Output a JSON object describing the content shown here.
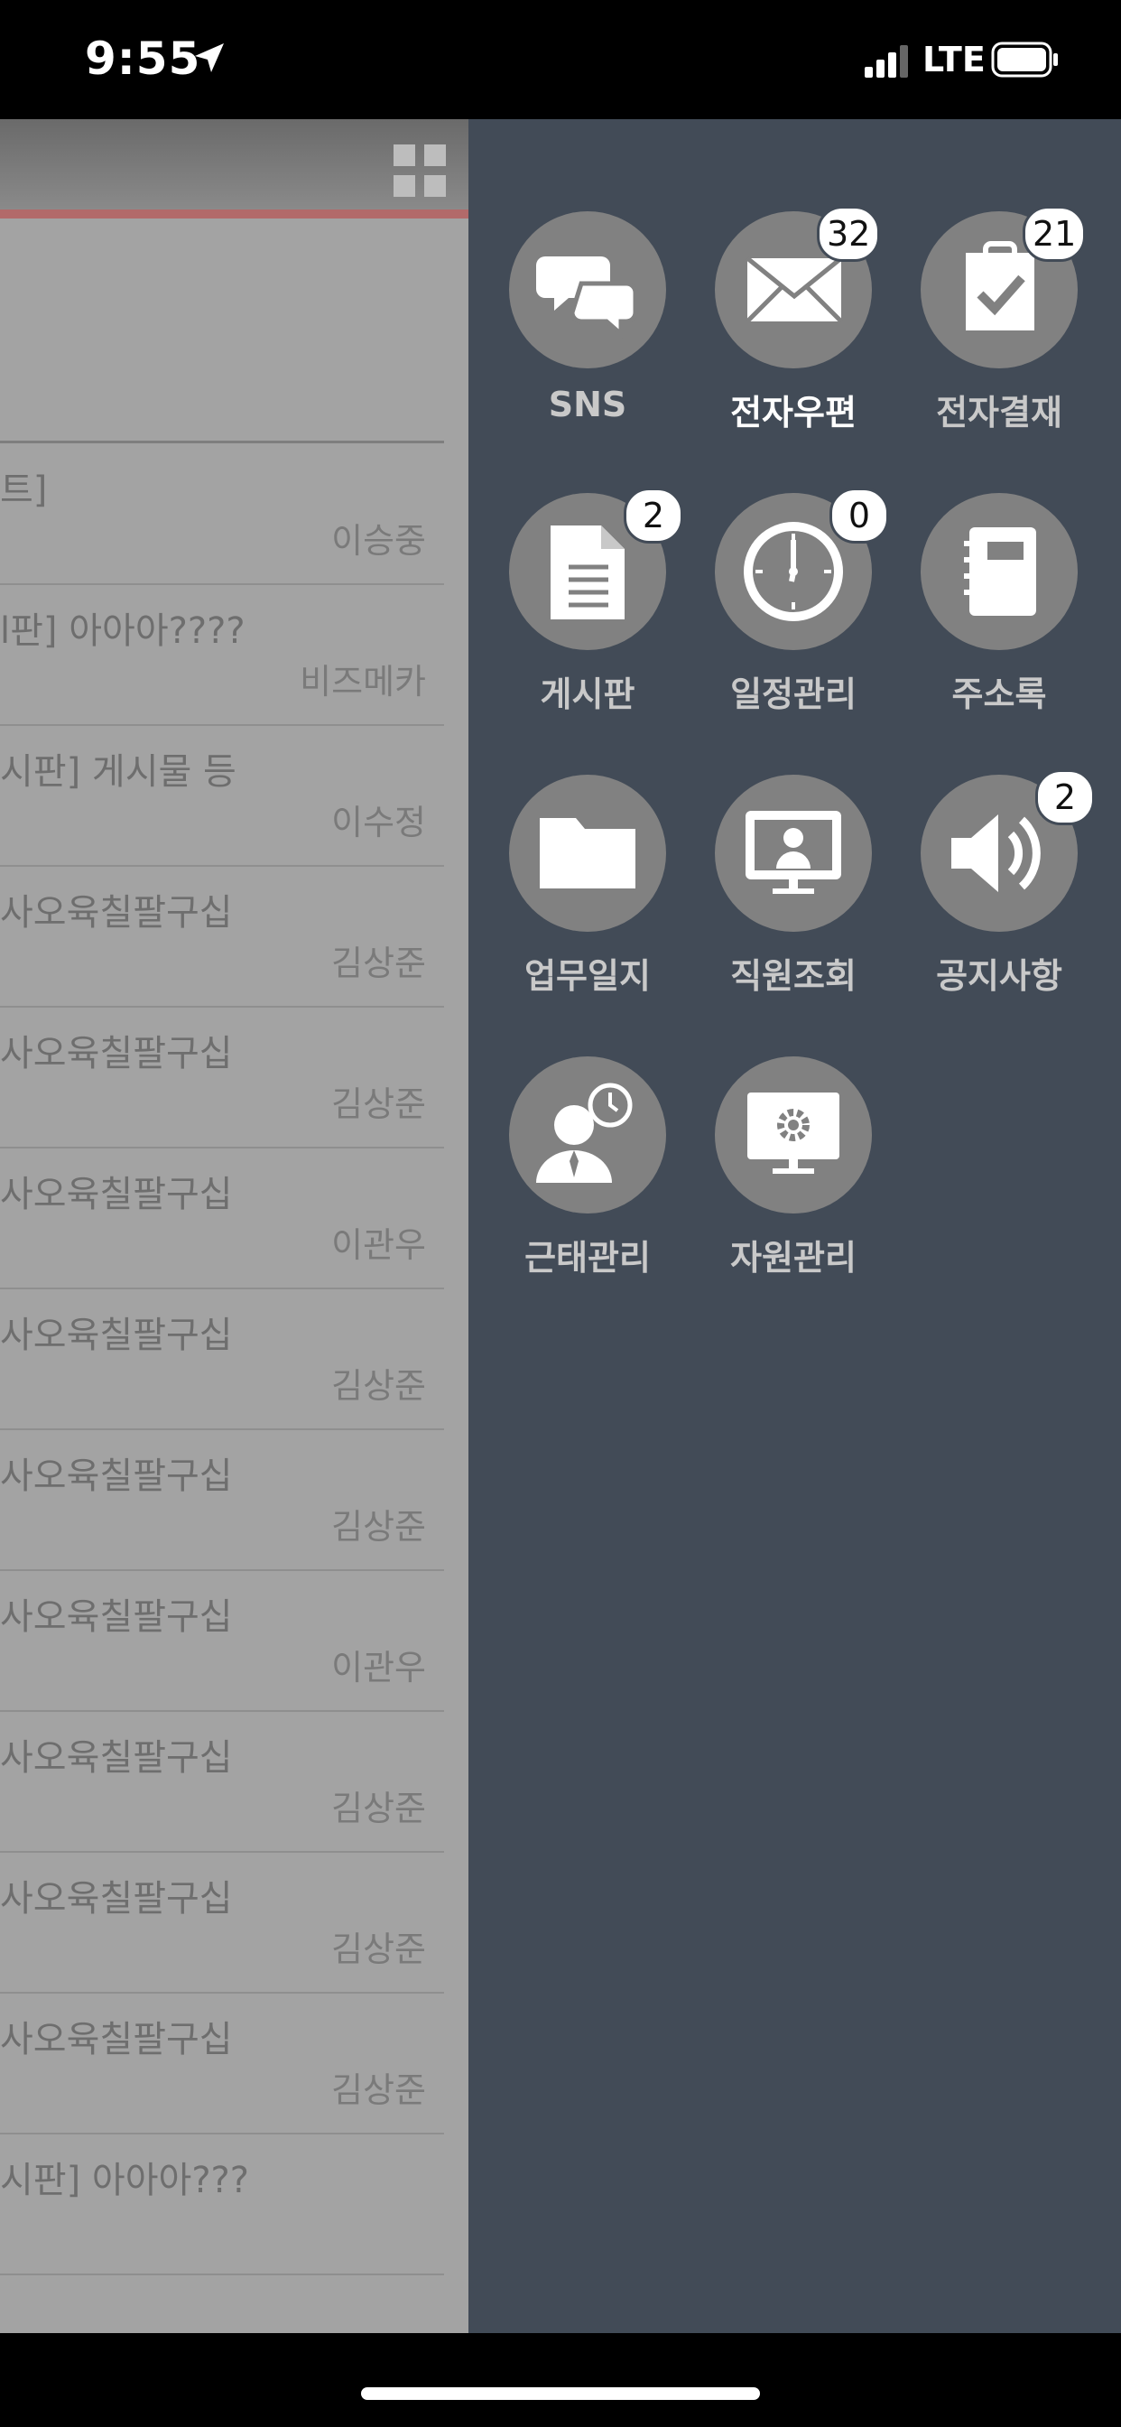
{
  "status_bar": {
    "time": "9:55",
    "network": "LTE"
  },
  "left_list": {
    "rows": [
      {
        "title": "트]",
        "author": "이승중"
      },
      {
        "title": "l판] 아아아????",
        "author": "비즈메카"
      },
      {
        "title": "시판] 게시물 등",
        "author": "이수정"
      },
      {
        "title": "사오육칠팔구십",
        "author": "김상준"
      },
      {
        "title": "사오육칠팔구십",
        "author": "김상준"
      },
      {
        "title": "사오육칠팔구십",
        "author": "이관우"
      },
      {
        "title": "사오육칠팔구십",
        "author": "김상준"
      },
      {
        "title": "사오육칠팔구십",
        "author": "김상준"
      },
      {
        "title": "사오육칠팔구십",
        "author": "이관우"
      },
      {
        "title": "사오육칠팔구십",
        "author": "김상준"
      },
      {
        "title": "사오육칠팔구십",
        "author": "김상준"
      },
      {
        "title": "사오육칠팔구십",
        "author": "김상준"
      },
      {
        "title": "시판] 아아아???",
        "author": ""
      }
    ]
  },
  "menu": {
    "items": [
      {
        "label": "SNS",
        "badge": "",
        "icon": "chat-bubbles-icon"
      },
      {
        "label": "전자우편",
        "badge": "32",
        "icon": "envelope-icon"
      },
      {
        "label": "전자결재",
        "badge": "21",
        "icon": "clipboard-check-icon"
      },
      {
        "label": "게시판",
        "badge": "2",
        "icon": "document-icon"
      },
      {
        "label": "일정관리",
        "badge": "0",
        "icon": "clock-icon"
      },
      {
        "label": "주소록",
        "badge": "",
        "icon": "address-book-icon"
      },
      {
        "label": "업무일지",
        "badge": "",
        "icon": "folder-icon"
      },
      {
        "label": "직원조회",
        "badge": "",
        "icon": "monitor-user-icon"
      },
      {
        "label": "공지사항",
        "badge": "2",
        "icon": "speaker-icon"
      },
      {
        "label": "근태관리",
        "badge": "",
        "icon": "person-clock-icon"
      },
      {
        "label": "자원관리",
        "badge": "",
        "icon": "monitor-gear-icon"
      }
    ]
  },
  "colors": {
    "panel_bg": "#424b57",
    "circle_bg": "#818181",
    "active_label": "#ffffff",
    "label": "#c9c9c9"
  }
}
